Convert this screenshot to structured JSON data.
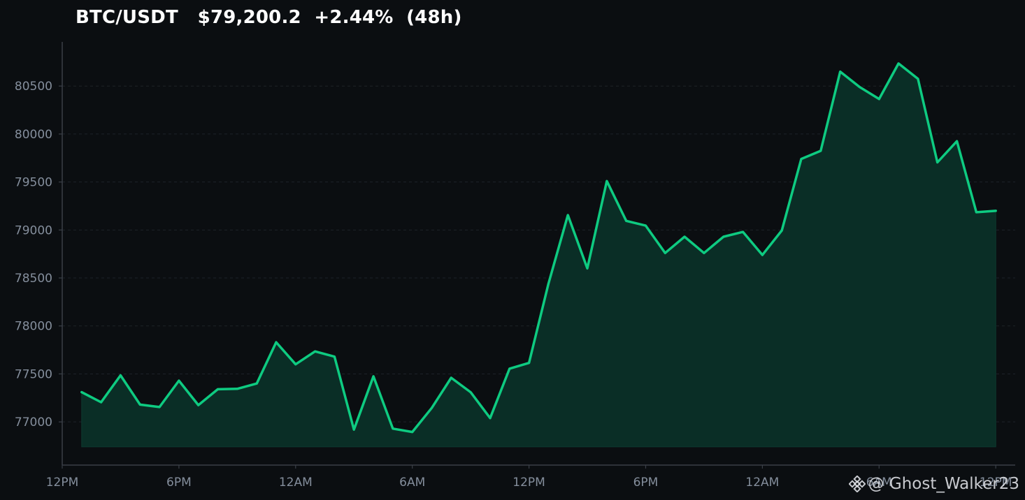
{
  "header": {
    "pair": "BTC/USDT",
    "price": "$79,200.2",
    "change": "+2.44%",
    "period": "(48h)"
  },
  "watermark": {
    "text": "@ Ghost_Walker23",
    "icon": "binance-logo-icon"
  },
  "colors": {
    "background": "#0b0e11",
    "line": "#0ecb81",
    "fill": "#0a2e26",
    "grid": "#1e2329",
    "axis": "#3a3f47",
    "tick_text": "#848e9c"
  },
  "chart_data": {
    "type": "area",
    "title": "BTC/USDT   $79,200.2  +2.44%  (48h)",
    "xlabel": "",
    "ylabel": "",
    "x_unit": "hours",
    "x": [
      1,
      2,
      3,
      4,
      5,
      6,
      7,
      8,
      9,
      10,
      11,
      12,
      13,
      14,
      15,
      16,
      17,
      18,
      19,
      20,
      21,
      22,
      23,
      24,
      25,
      26,
      27,
      28,
      29,
      30,
      31,
      32,
      33,
      34,
      35,
      36,
      37,
      38,
      39,
      40,
      41,
      42,
      43,
      44,
      45,
      46,
      47,
      48
    ],
    "y": [
      77310,
      77205,
      77485,
      77180,
      77155,
      77430,
      77175,
      77340,
      77345,
      77400,
      77830,
      77600,
      77735,
      77680,
      76920,
      77475,
      76930,
      76895,
      77145,
      77460,
      77310,
      77040,
      77555,
      77615,
      78440,
      79155,
      78600,
      79510,
      79095,
      79045,
      78760,
      78930,
      78760,
      78930,
      78980,
      78740,
      78995,
      79740,
      79825,
      80650,
      80490,
      80365,
      80735,
      80575,
      79705,
      79925,
      79185,
      79200
    ],
    "series": [
      {
        "name": "",
        "values": "y"
      }
    ],
    "xlim": [
      0,
      49
    ],
    "ylim": [
      76550,
      80960
    ],
    "fill_baseline": 76740,
    "x_ticks": [
      0,
      6,
      12,
      18,
      24,
      30,
      36,
      42,
      48
    ],
    "x_tick_labels": [
      "12PM",
      "6PM",
      "12AM",
      "6AM",
      "12PM",
      "6PM",
      "12AM",
      "6AM",
      "12PM"
    ],
    "y_ticks": [
      77000,
      77500,
      78000,
      78500,
      79000,
      79500,
      80000,
      80500
    ],
    "y_tick_labels": [
      "77000",
      "77500",
      "78000",
      "78500",
      "79000",
      "79500",
      "80000",
      "80500"
    ],
    "grid": true,
    "legend": "none"
  }
}
